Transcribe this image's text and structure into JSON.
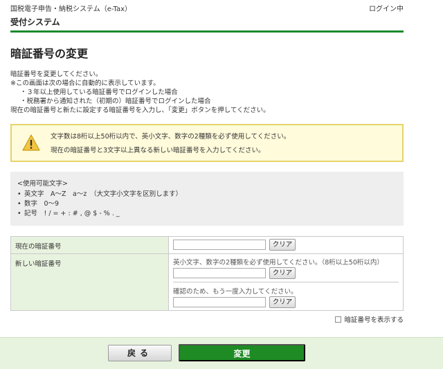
{
  "header": {
    "system_title": "国税電子申告・納税システム（e-Tax）",
    "login_status": "ログイン中",
    "subtitle": "受付システム"
  },
  "page_title": "暗証番号の変更",
  "intro": {
    "line1": "暗証番号を変更してください。",
    "line2": "※この画面は次の場合に自動的に表示しています。",
    "line3": "・３年以上使用している暗証番号でログインした場合",
    "line4": "・税務署から通知された（初期の）暗証番号でログインした場合",
    "line5": "現在の暗証番号と新たに設定する暗証番号を入力し、「変更」ボタンを押してください。"
  },
  "warning": {
    "icon": "warning-icon",
    "line1": "文字数は8桁以上50桁以内で、英小文字、数字の2種類を必ず使用してください。",
    "line2": "現在の暗証番号と3文字以上異なる新しい暗証番号を入力してください。",
    "border_color": "#e6d36a",
    "background": "#fffbdb"
  },
  "usable_chars": {
    "title": "<使用可能文字>",
    "items": [
      "英文字　A～Z　a～z　（大文字小文字を区別します）",
      "数字　0～9",
      "記号　! / = + : # , @ $ - % . _"
    ]
  },
  "form": {
    "current_label": "現在の暗証番号",
    "new_label": "新しい暗証番号",
    "current_value": "",
    "new_value": "",
    "confirm_value": "",
    "new_hint": "英小文字、数字の2種類を必ず使用してください。（8桁以上50桁以内）",
    "confirm_hint": "確認のため、もう一度入力してください。",
    "clear_label": "クリア"
  },
  "show_password": {
    "label": "暗証番号を表示する",
    "checked": false
  },
  "footer": {
    "back_label": "戻る",
    "change_label": "変更"
  },
  "colors": {
    "accent_green": "#1a8a2c",
    "label_bg": "#e8f3df"
  }
}
